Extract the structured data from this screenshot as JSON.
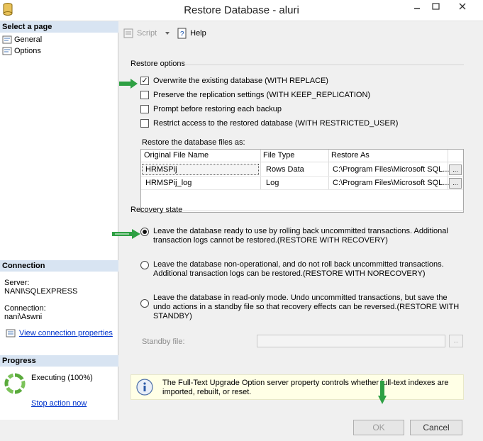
{
  "window": {
    "title": "Restore Database - aluri"
  },
  "left_pane": {
    "select_page_header": "Select a page",
    "pages": [
      {
        "label": "General"
      },
      {
        "label": "Options"
      }
    ],
    "connection_header": "Connection",
    "server_label": "Server:",
    "server_value": "NANI\\SQLEXPRESS",
    "connection_label": "Connection:",
    "connection_value": "nani\\Aswni",
    "view_connection_link": "View connection properties",
    "progress_header": "Progress",
    "progress_status": "Executing (100%)",
    "progress_fraction": 1.0,
    "stop_action_link": "Stop action now"
  },
  "toolbar": {
    "script_label": "Script",
    "help_label": "Help"
  },
  "restore_options": {
    "group_label": "Restore options",
    "checkboxes": [
      {
        "label": "Overwrite the existing database (WITH REPLACE)",
        "checked": true
      },
      {
        "label": "Preserve the replication settings (WITH KEEP_REPLICATION)",
        "checked": false
      },
      {
        "label": "Prompt before restoring each backup",
        "checked": false
      },
      {
        "label": "Restrict access to the restored database (WITH RESTRICTED_USER)",
        "checked": false
      }
    ],
    "files_label": "Restore the database files as:",
    "grid": {
      "columns": [
        "Original File Name",
        "File Type",
        "Restore As"
      ],
      "rows": [
        {
          "original": "HRMSPij",
          "type": "Rows Data",
          "restore_as": "C:\\Program Files\\Microsoft SQL..."
        },
        {
          "original": "HRMSPij_log",
          "type": "Log",
          "restore_as": "C:\\Program Files\\Microsoft SQL..."
        }
      ],
      "ellipsis": "..."
    }
  },
  "recovery_state": {
    "group_label": "Recovery state",
    "options": [
      {
        "label": "Leave the database ready to use by rolling back uncommitted transactions. Additional transaction logs cannot be restored.(RESTORE WITH RECOVERY)",
        "selected": true
      },
      {
        "label": "Leave the database non-operational, and do not roll back uncommitted transactions. Additional transaction logs can be restored.(RESTORE WITH NORECOVERY)",
        "selected": false
      },
      {
        "label": "Leave the database in read-only mode. Undo uncommitted transactions, but save the undo actions in a standby file so that recovery effects can be reversed.(RESTORE WITH STANDBY)",
        "selected": false
      }
    ],
    "standby_label": "Standby file:",
    "standby_value": "",
    "standby_button": "..."
  },
  "info_message": "The Full-Text Upgrade Option server property controls whether full-text indexes are imported, rebuilt, or reset.",
  "buttons": {
    "ok": "OK",
    "cancel": "Cancel"
  },
  "colors": {
    "annotation_arrow": "#2ea043",
    "link": "#0033cc",
    "pane_header": "#d8e4f2",
    "info_background": "#ffffe6"
  }
}
